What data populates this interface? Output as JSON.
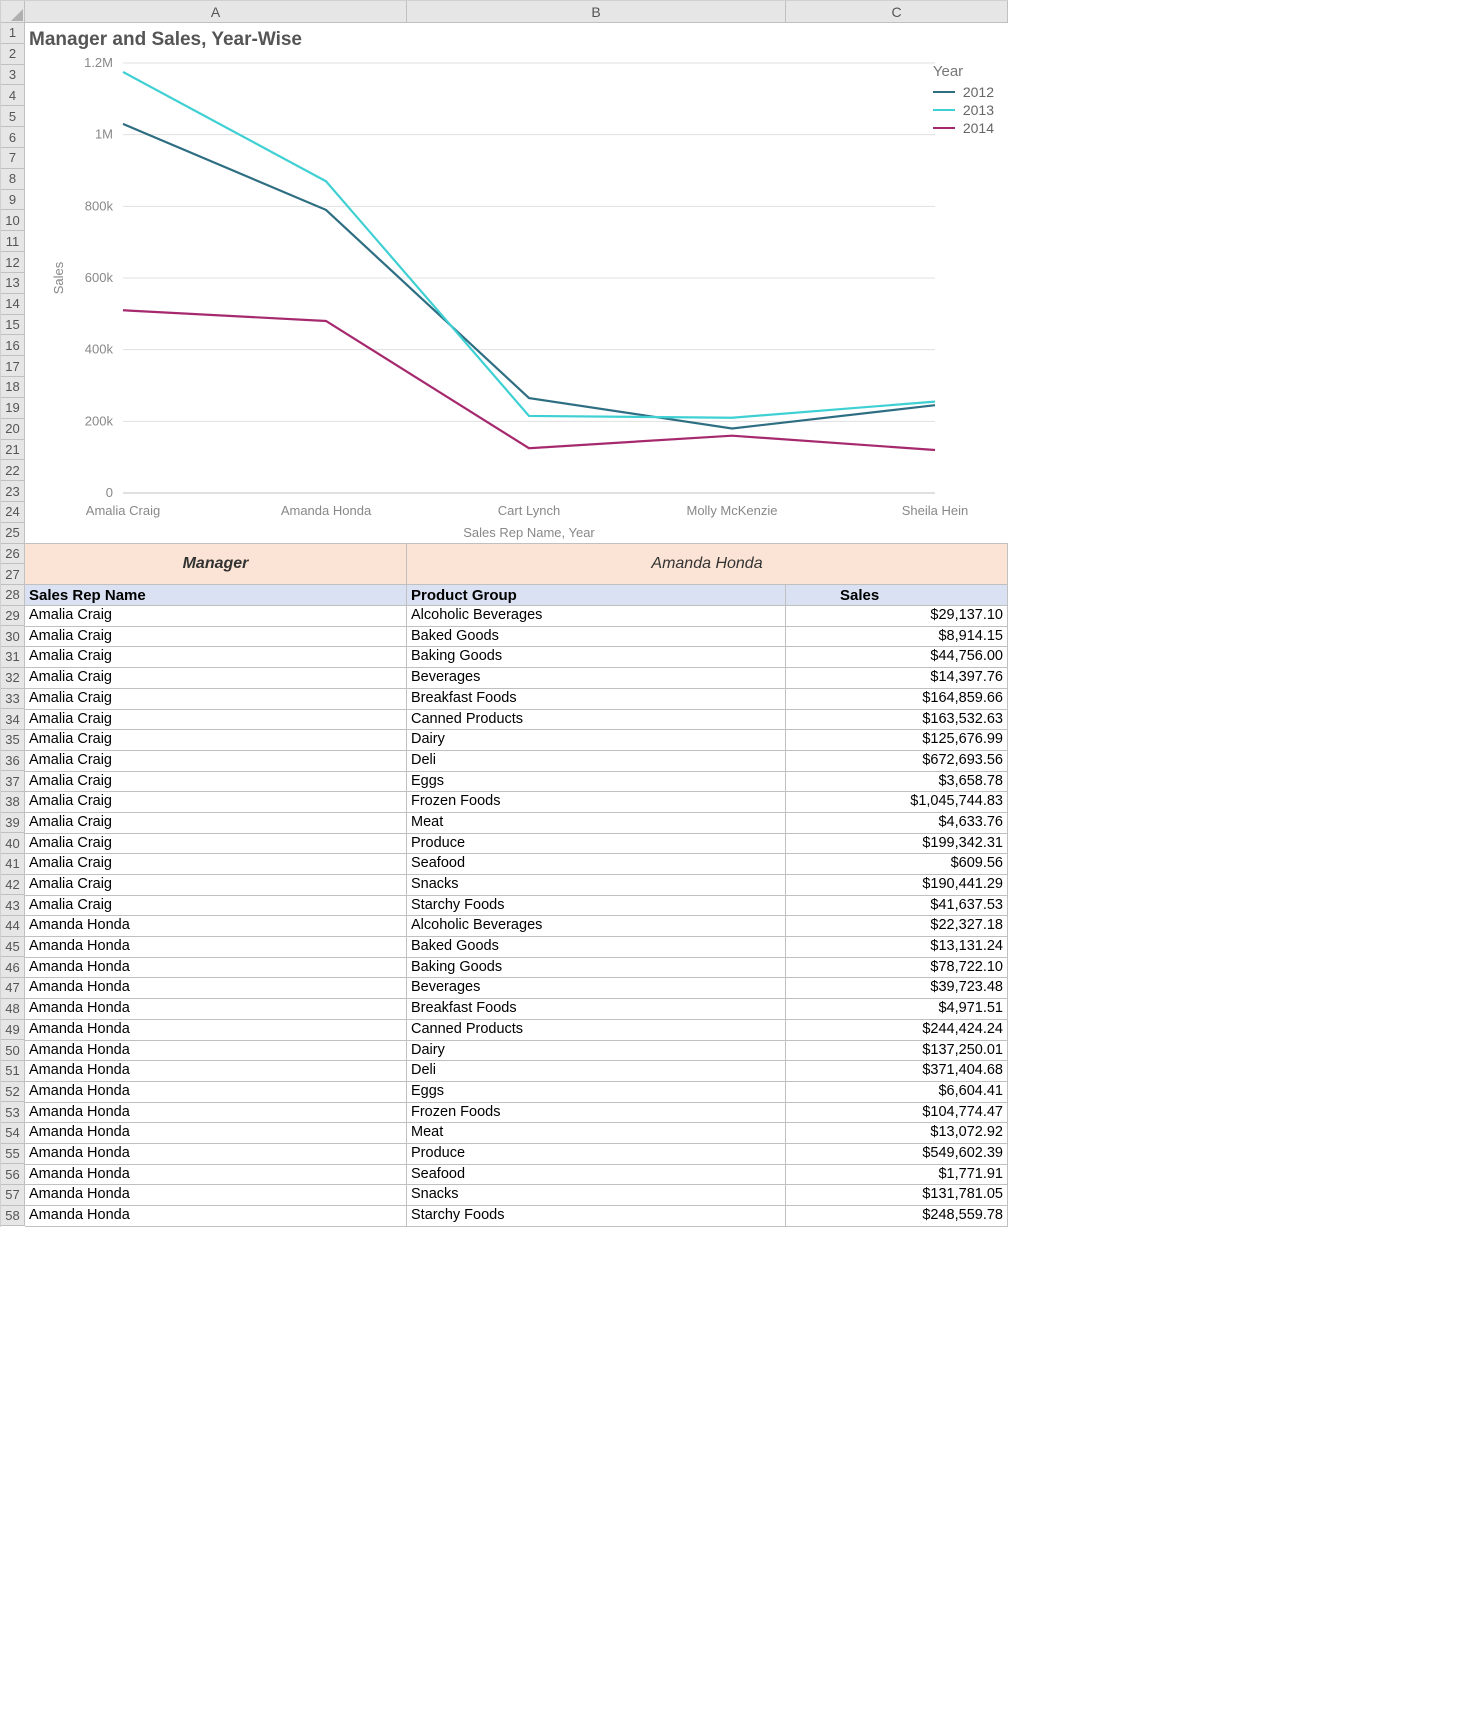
{
  "columns": [
    "A",
    "B",
    "C"
  ],
  "row_start": 1,
  "row_end": 58,
  "chart_rows": 25,
  "merged_rows": 2,
  "header_row_ix": 28,
  "chart_title": "Manager and Sales, Year-Wise",
  "y_axis_label": "Sales",
  "x_axis_label": "Sales Rep Name, Year",
  "legend_title": "Year",
  "merged": {
    "left": "Manager",
    "right": "Amanda Honda"
  },
  "table_headers": {
    "A": "Sales Rep Name",
    "B": "Product Group",
    "C": "Sales"
  },
  "rows": [
    {
      "A": "Amalia Craig",
      "B": "Alcoholic Beverages",
      "C": "$29,137.10"
    },
    {
      "A": "Amalia Craig",
      "B": "Baked Goods",
      "C": "$8,914.15"
    },
    {
      "A": "Amalia Craig",
      "B": "Baking Goods",
      "C": "$44,756.00"
    },
    {
      "A": "Amalia Craig",
      "B": "Beverages",
      "C": "$14,397.76"
    },
    {
      "A": "Amalia Craig",
      "B": "Breakfast Foods",
      "C": "$164,859.66"
    },
    {
      "A": "Amalia Craig",
      "B": "Canned Products",
      "C": "$163,532.63"
    },
    {
      "A": "Amalia Craig",
      "B": "Dairy",
      "C": "$125,676.99"
    },
    {
      "A": "Amalia Craig",
      "B": "Deli",
      "C": "$672,693.56"
    },
    {
      "A": "Amalia Craig",
      "B": "Eggs",
      "C": "$3,658.78"
    },
    {
      "A": "Amalia Craig",
      "B": "Frozen Foods",
      "C": "$1,045,744.83"
    },
    {
      "A": "Amalia Craig",
      "B": "Meat",
      "C": "$4,633.76"
    },
    {
      "A": "Amalia Craig",
      "B": "Produce",
      "C": "$199,342.31"
    },
    {
      "A": "Amalia Craig",
      "B": "Seafood",
      "C": "$609.56"
    },
    {
      "A": "Amalia Craig",
      "B": "Snacks",
      "C": "$190,441.29"
    },
    {
      "A": "Amalia Craig",
      "B": "Starchy Foods",
      "C": "$41,637.53"
    },
    {
      "A": "Amanda Honda",
      "B": "Alcoholic Beverages",
      "C": "$22,327.18"
    },
    {
      "A": "Amanda Honda",
      "B": "Baked Goods",
      "C": "$13,131.24"
    },
    {
      "A": "Amanda Honda",
      "B": "Baking Goods",
      "C": "$78,722.10"
    },
    {
      "A": "Amanda Honda",
      "B": "Beverages",
      "C": "$39,723.48"
    },
    {
      "A": "Amanda Honda",
      "B": "Breakfast Foods",
      "C": "$4,971.51"
    },
    {
      "A": "Amanda Honda",
      "B": "Canned Products",
      "C": "$244,424.24"
    },
    {
      "A": "Amanda Honda",
      "B": "Dairy",
      "C": "$137,250.01"
    },
    {
      "A": "Amanda Honda",
      "B": "Deli",
      "C": "$371,404.68"
    },
    {
      "A": "Amanda Honda",
      "B": "Eggs",
      "C": "$6,604.41"
    },
    {
      "A": "Amanda Honda",
      "B": "Frozen Foods",
      "C": "$104,774.47"
    },
    {
      "A": "Amanda Honda",
      "B": "Meat",
      "C": "$13,072.92"
    },
    {
      "A": "Amanda Honda",
      "B": "Produce",
      "C": "$549,602.39"
    },
    {
      "A": "Amanda Honda",
      "B": "Seafood",
      "C": "$1,771.91"
    },
    {
      "A": "Amanda Honda",
      "B": "Snacks",
      "C": "$131,781.05"
    },
    {
      "A": "Amanda Honda",
      "B": "Starchy Foods",
      "C": "$248,559.78"
    }
  ],
  "chart_data": {
    "type": "line",
    "title": "Manager and Sales, Year-Wise",
    "xlabel": "Sales Rep Name, Year",
    "ylabel": "Sales",
    "ylim": [
      0,
      1200000
    ],
    "y_ticks": [
      0,
      200000,
      400000,
      600000,
      800000,
      1000000,
      1200000
    ],
    "y_tick_labels": [
      "0",
      "200k",
      "400k",
      "600k",
      "800k",
      "1M",
      "1.2M"
    ],
    "categories": [
      "Amalia Craig",
      "Amanda Honda",
      "Cart Lynch",
      "Molly McKenzie",
      "Sheila Hein"
    ],
    "series": [
      {
        "name": "2012",
        "color": "#2E6E82",
        "values": [
          1030000,
          790000,
          265000,
          180000,
          245000
        ]
      },
      {
        "name": "2013",
        "color": "#3ED0D3",
        "values": [
          1175000,
          870000,
          215000,
          210000,
          255000
        ]
      },
      {
        "name": "2014",
        "color": "#A6296E",
        "values": [
          510000,
          480000,
          125000,
          160000,
          120000
        ]
      }
    ]
  }
}
